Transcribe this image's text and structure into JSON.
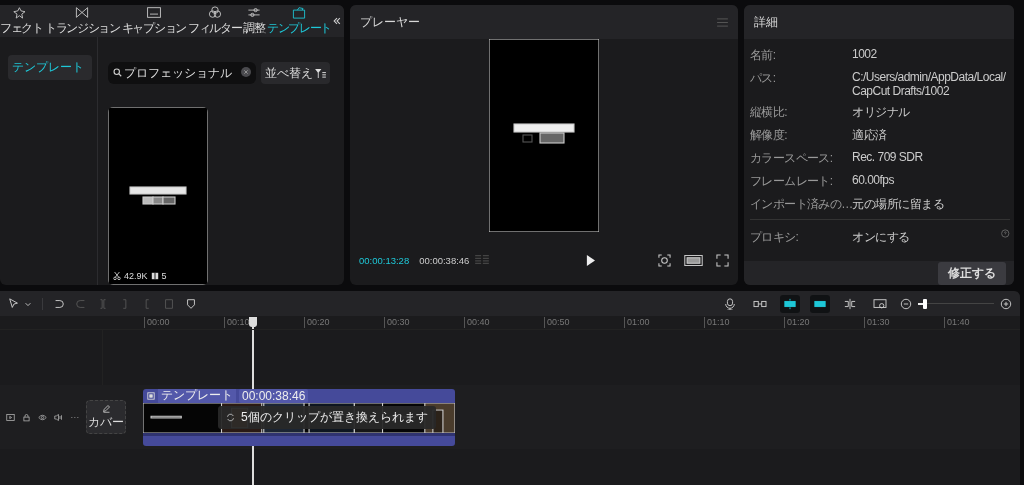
{
  "media_tabs": [
    {
      "label": "フェクト",
      "selected": false
    },
    {
      "label": "トランジション",
      "selected": false
    },
    {
      "label": "キャプション",
      "selected": false
    },
    {
      "label": "フィルター",
      "selected": false
    },
    {
      "label": "調整",
      "selected": false
    },
    {
      "label": "テンプレート",
      "selected": true
    }
  ],
  "sidebar": {
    "items": [
      {
        "label": "テンプレート",
        "selected": true
      }
    ]
  },
  "search": {
    "value": "プロフェッショナル"
  },
  "sort_button": "並べ替え",
  "template_card": {
    "uses": "42.9K",
    "clips": "5"
  },
  "player": {
    "title": "プレーヤー",
    "current_time": "00:00:13:28",
    "total_time": "00:00:38:46"
  },
  "details": {
    "title": "詳細",
    "rows": [
      {
        "label": "名前:",
        "value": "1002"
      },
      {
        "label": "パス:",
        "value": "C:/Users/admin/AppData/Local/ CapCut Drafts/1002"
      },
      {
        "label": "縦横比:",
        "value": "オリジナル"
      },
      {
        "label": "解像度:",
        "value": "適応済"
      },
      {
        "label": "カラースペース:",
        "value": "Rec. 709 SDR"
      },
      {
        "label": "フレームレート:",
        "value": "60.00fps"
      },
      {
        "label": "インポート済みの…",
        "value": "元の場所に留まる"
      }
    ],
    "proxy": {
      "label": "プロキシ:",
      "value": "オンにする"
    },
    "button": "修正する"
  },
  "timeline": {
    "toolbar_right": [
      {
        "on": false
      },
      {
        "on": false
      },
      {
        "on": true
      },
      {
        "on": true
      },
      {
        "on": false
      },
      {
        "on": false
      }
    ],
    "zoom": {
      "level": 0.06
    },
    "ruler": [
      "00:00",
      "00:10",
      "00:20",
      "00:30",
      "00:40",
      "00:50",
      "01:00",
      "01:10",
      "01:20",
      "01:30",
      "01:40"
    ],
    "cover_button": "カバー",
    "clip": {
      "name": "テンプレート",
      "duration": "00:00:38:46",
      "notice": "5個のクリップが置き換えられます"
    }
  }
}
